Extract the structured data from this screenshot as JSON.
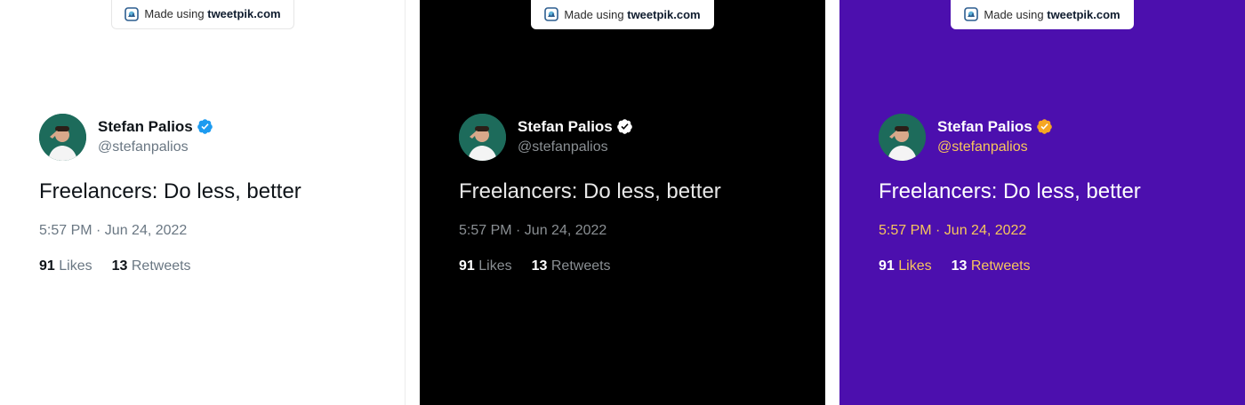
{
  "badge": {
    "prefix": "Made using",
    "brand": "tweetpik.com"
  },
  "tweet": {
    "name": "Stefan Palios",
    "handle": "@stefanpalios",
    "text": "Freelancers: Do less, better",
    "timestamp": "5:57 PM · Jun 24, 2022",
    "likes_count": "91",
    "likes_label": "Likes",
    "retweets_count": "13",
    "retweets_label": "Retweets"
  },
  "themes": {
    "white": {
      "background": "#ffffff",
      "verified": "#1d9bf0"
    },
    "black": {
      "background": "#000000",
      "verified": "#ffffff"
    },
    "purple": {
      "background": "#4c0fae",
      "verified": "#f5a623"
    }
  }
}
